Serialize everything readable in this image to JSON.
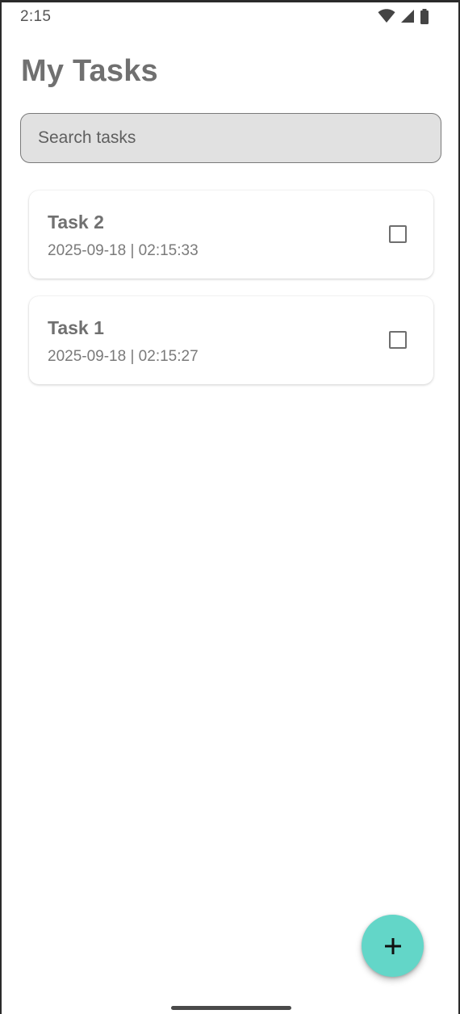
{
  "status_bar": {
    "time": "2:15",
    "icons": [
      "wifi-icon",
      "cellular-signal-icon",
      "battery-icon"
    ]
  },
  "header": {
    "title": "My Tasks"
  },
  "search": {
    "placeholder": "Search tasks",
    "value": ""
  },
  "tasks": [
    {
      "title": "Task 2",
      "timestamp": "2025-09-18 | 02:15:33",
      "checked": false
    },
    {
      "title": "Task 1",
      "timestamp": "2025-09-18 | 02:15:27",
      "checked": false
    }
  ],
  "fab": {
    "icon": "plus-icon"
  },
  "colors": {
    "fab_background": "#63d6c8",
    "title_text": "#707070",
    "search_background": "#e1e1e1"
  }
}
